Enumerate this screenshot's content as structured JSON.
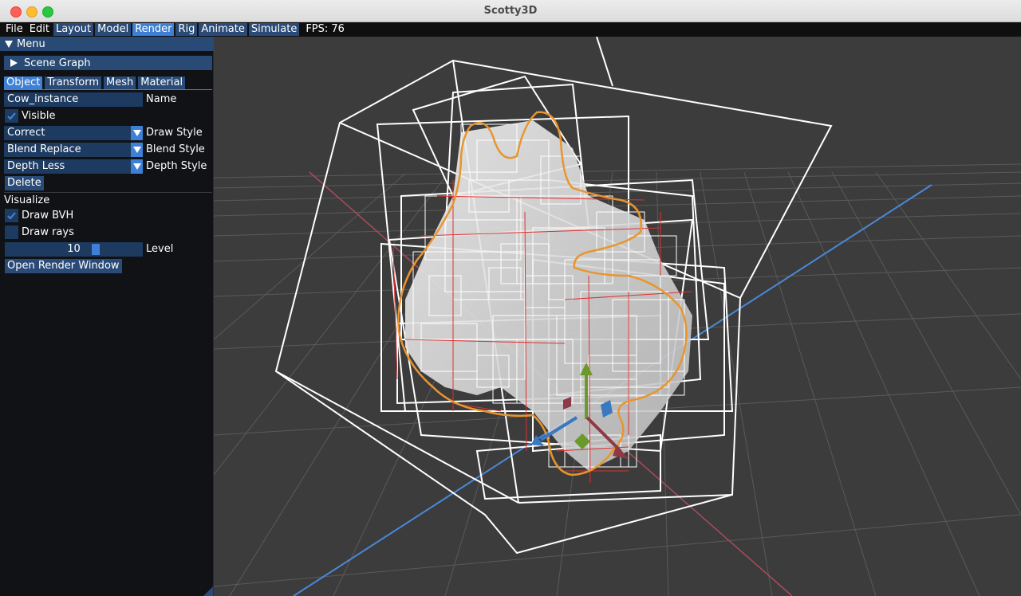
{
  "window": {
    "title": "Scotty3D"
  },
  "menubar": {
    "items": [
      "File",
      "Edit",
      "Layout",
      "Model",
      "Render",
      "Rig",
      "Animate",
      "Simulate"
    ],
    "fps": "FPS: 76"
  },
  "panel": {
    "title": "Menu",
    "scene_graph": "Scene Graph",
    "tabs": [
      "Object",
      "Transform",
      "Mesh",
      "Material"
    ],
    "name_field": {
      "value": "Cow_instance",
      "label": "Name"
    },
    "visible": {
      "label": "Visible",
      "checked": true
    },
    "draw_style": {
      "value": "Correct",
      "label": "Draw Style"
    },
    "blend_style": {
      "value": "Blend Replace",
      "label": "Blend Style"
    },
    "depth_style": {
      "value": "Depth Less",
      "label": "Depth Style"
    },
    "delete_button": "Delete",
    "visualize": {
      "heading": "Visualize",
      "draw_bvh": {
        "label": "Draw BVH",
        "checked": true
      },
      "draw_rays": {
        "label": "Draw rays",
        "checked": false
      },
      "level": {
        "value": "10",
        "label": "Level"
      }
    },
    "open_render_window": "Open Render Window"
  },
  "colors": {
    "accent": "#3e80d6",
    "header": "#284a74",
    "field": "#1d3a60",
    "outline": "#e8952e",
    "bvh_box": "#ffffff",
    "gizmo_x": "#8e3a46",
    "gizmo_y": "#6a9a2a",
    "gizmo_z": "#3a78c0"
  }
}
